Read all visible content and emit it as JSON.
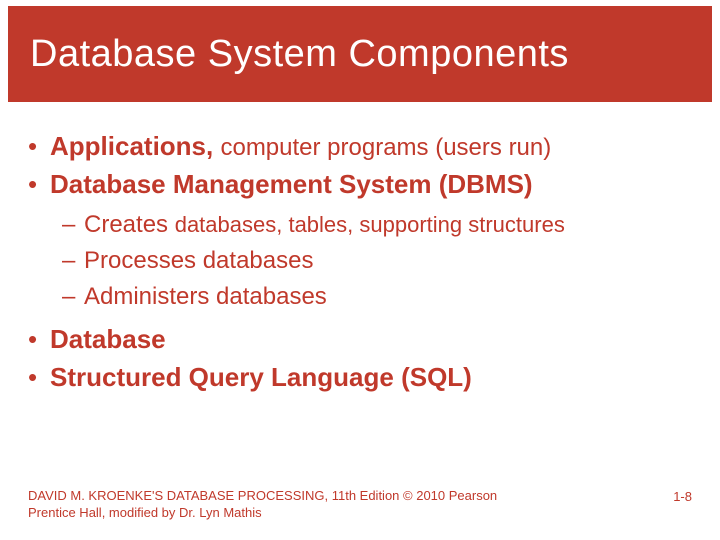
{
  "title": "Database System Components",
  "bullets": {
    "b1_bold": "Applications, ",
    "b1_rest": "computer programs (users run)",
    "b2": "Database Management System (DBMS)",
    "b2_sub1_lead": "Creates ",
    "b2_sub1_rest": "databases, tables, supporting structures",
    "b2_sub2": "Processes databases",
    "b2_sub3": "Administers databases",
    "b3": "Database",
    "b4": "Structured Query Language (SQL)"
  },
  "footer": {
    "left": "DAVID M. KROENKE'S DATABASE PROCESSING, 11th Edition  © 2010 Pearson Prentice Hall,  modified by Dr. Lyn Mathis",
    "right": "1-8"
  }
}
